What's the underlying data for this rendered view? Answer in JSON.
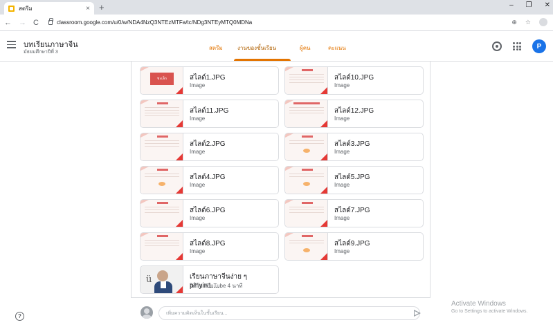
{
  "browser": {
    "tab_title": "สตรีม",
    "tab_close": "×",
    "new_tab": "+",
    "url": "classroom.google.com/u/0/w/NDA4NzQ3NTEzMTFa/tc/NDg3NTEyMTQ0MDNa",
    "win_min": "–",
    "win_max": "❐",
    "win_close": "✕",
    "back": "←",
    "forward": "→",
    "reload": "C",
    "zoom": "⊕",
    "star": "☆"
  },
  "header": {
    "class_name": "บทเรียนภาษาจีน",
    "class_section": "มัธยมศึกษาปีที่ 3",
    "tabs": [
      {
        "label": "สตรีม"
      },
      {
        "label": "งานของชั้นเรียน"
      },
      {
        "label": "ผู้คน"
      },
      {
        "label": "คะแนน"
      }
    ],
    "avatar_letter": "P"
  },
  "attachments": [
    {
      "name": "สไลด์1.JPG",
      "type": "Image"
    },
    {
      "name": "สไลด์10.JPG",
      "type": "Image"
    },
    {
      "name": "สไลด์11.JPG",
      "type": "Image"
    },
    {
      "name": "สไลด์12.JPG",
      "type": "Image"
    },
    {
      "name": "สไลด์2.JPG",
      "type": "Image"
    },
    {
      "name": "สไลด์3.JPG",
      "type": "Image"
    },
    {
      "name": "สไลด์4.JPG",
      "type": "Image"
    },
    {
      "name": "สไลด์5.JPG",
      "type": "Image"
    },
    {
      "name": "สไลด์6.JPG",
      "type": "Image"
    },
    {
      "name": "สไลด์7.JPG",
      "type": "Image"
    },
    {
      "name": "สไลด์8.JPG",
      "type": "Image"
    },
    {
      "name": "สไลด์9.JPG",
      "type": "Image"
    }
  ],
  "title_slide_text": "ชะเล็ก",
  "video": {
    "title": "เรียนภาษาจีนง่าย ๆ pinyin1....",
    "meta": "วิดีโอ YouTube  4 นาที",
    "thumb_glyph": "ü"
  },
  "comment": {
    "placeholder": "เพิ่มความคิดเห็นในชั้นเรียน..."
  },
  "help_glyph": "?",
  "watermark": {
    "line1": "Activate Windows",
    "line2": "Go to Settings to activate Windows."
  },
  "colors": {
    "accent": "#e37400",
    "avatar": "#1a73e8"
  }
}
